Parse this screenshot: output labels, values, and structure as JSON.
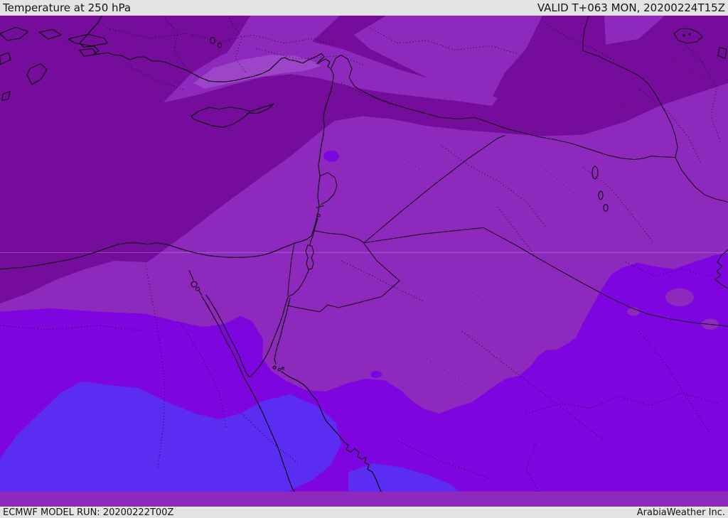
{
  "header": {
    "title": "Temperature at 250 hPa",
    "valid_label": "VALID T+063 MON, 20200224T15Z"
  },
  "footer": {
    "model_run": "ECMWF MODEL RUN: 20200222T00Z",
    "brand": "ArabiaWeather Inc."
  },
  "map": {
    "kind": "temperature-contour-fill-forecast-map",
    "parameter": "Temperature",
    "level": "250 hPa",
    "valid_time": "20200224T15Z",
    "lead_hours": "T+063",
    "model": "ECMWF",
    "run_time": "20200222T00Z"
  },
  "colors": {
    "bar_bg": "#e4e4e4",
    "bar_text": "#151515",
    "line_color": "#0d0d0d",
    "graticule": "#efd7ff",
    "map_darkest": "#750c9b",
    "map_medium": "#8d29bc",
    "map_medium_light": "#9c45c8",
    "map_bright": "#7f05e0",
    "map_blue": "#5b2df3"
  }
}
